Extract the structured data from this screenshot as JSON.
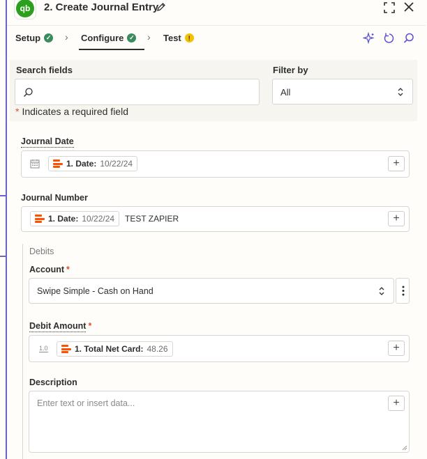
{
  "header": {
    "title": "2. Create Journal Entry",
    "logo_text": "qb",
    "icons": [
      "pencil-icon",
      "expand-icon",
      "close-icon"
    ]
  },
  "tabs": [
    {
      "label": "Setup",
      "status": "complete"
    },
    {
      "label": "Configure",
      "status": "complete",
      "active": true
    },
    {
      "label": "Test",
      "status": "warning"
    }
  ],
  "toolbar_icons": [
    "ai-sparkle-icon",
    "refresh-icon",
    "search-icon"
  ],
  "search": {
    "label": "Search fields",
    "placeholder": "",
    "filter_label": "Filter by",
    "filter_value": "All"
  },
  "required_note": "Indicates a required field",
  "fields": {
    "journal_date": {
      "label": "Journal Date",
      "pill_key": "1. Date:",
      "pill_value": "10/22/24"
    },
    "journal_number": {
      "label": "Journal Number",
      "pill_key": "1. Date:",
      "pill_value": "10/22/24",
      "extra_text": "TEST ZAPIER"
    },
    "debits": {
      "group_label": "Debits",
      "account_label": "Account",
      "account_value": "Swipe Simple - Cash on Hand",
      "amount_label": "Debit Amount",
      "amount_prefix": "1.0",
      "amount_pill_key": "1. Total Net Card:",
      "amount_pill_value": "48.26",
      "description_label": "Description",
      "description_placeholder": "Enter text or insert data..."
    }
  },
  "colors": {
    "accent": "#6c63c9",
    "zapier_orange": "#ff4f00",
    "success": "#3a8c5f",
    "warning": "#f2c200",
    "required": "#d7502e"
  }
}
